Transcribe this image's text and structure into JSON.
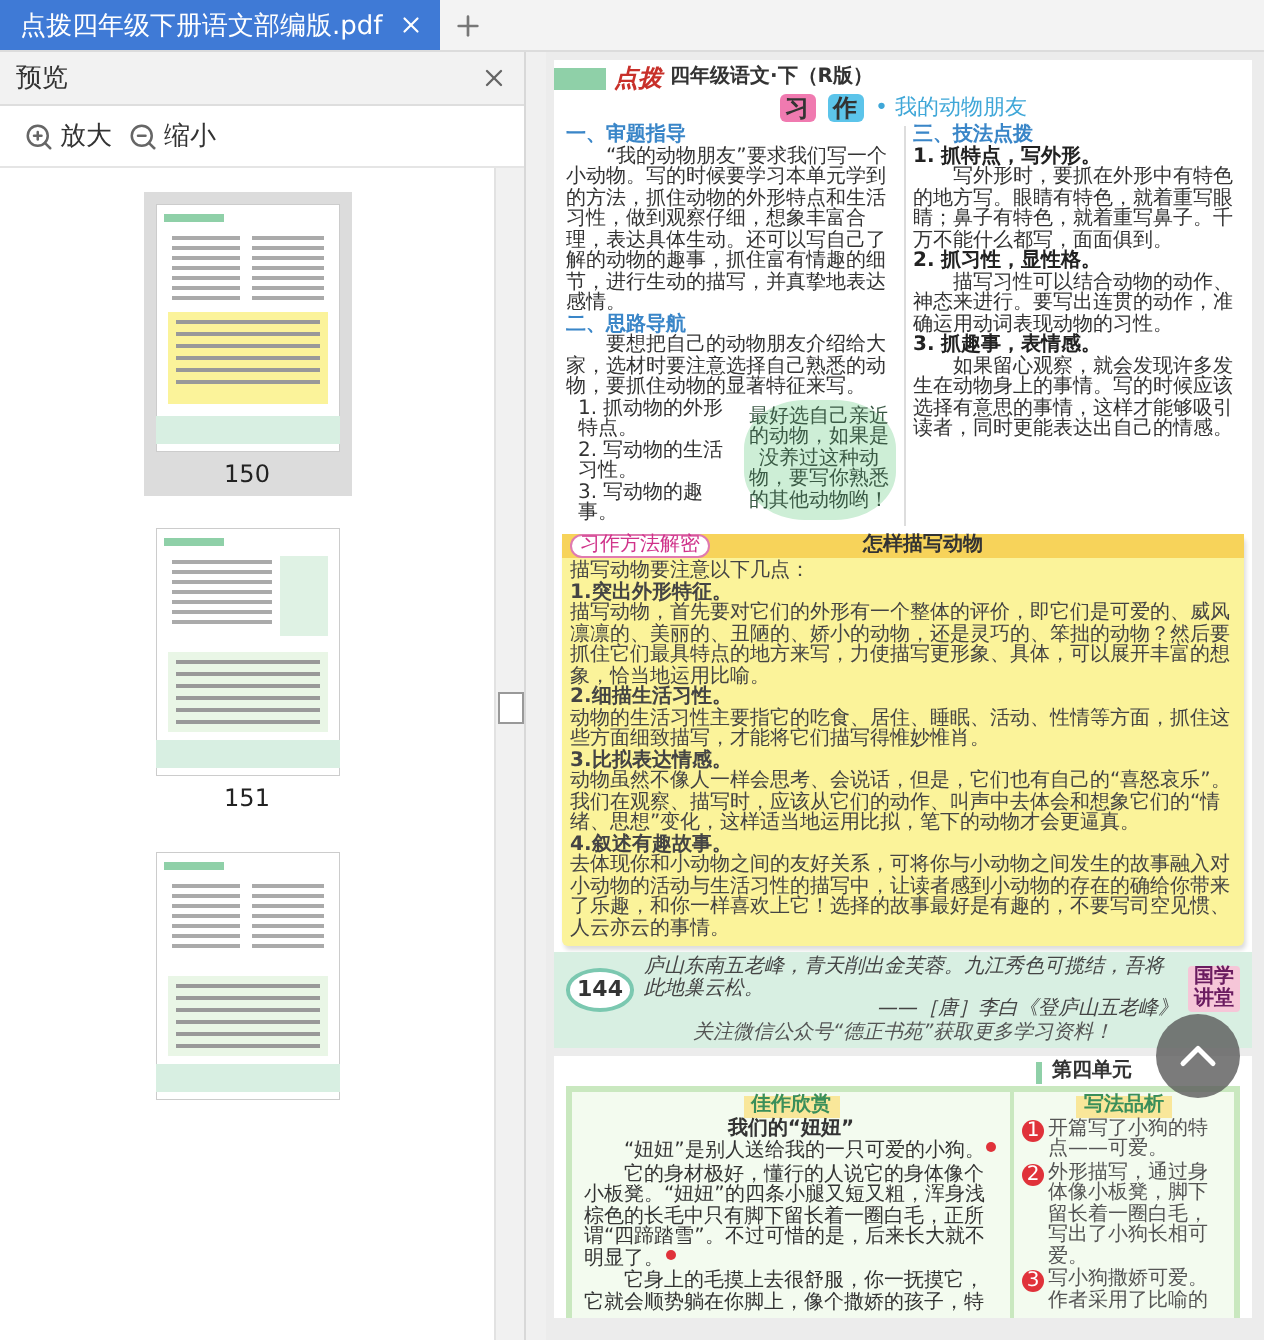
{
  "tab": {
    "title": "点拨四年级下册语文部编版.pdf",
    "selected": true
  },
  "sidebar": {
    "title": "预览",
    "zoom_in": "放大",
    "zoom_out": "缩小",
    "thumbnails": [
      {
        "label": "150",
        "selected": true
      },
      {
        "label": "151",
        "selected": false
      },
      {
        "selected": false
      }
    ]
  },
  "page_1": {
    "brand": "点拨",
    "header": "四年级语文·下（R版）",
    "section_badge": [
      "习",
      "作"
    ],
    "section_title": "• 我的动物朋友",
    "columns": [
      [
        {
          "kind": "heading",
          "text": "一、审题指导"
        },
        {
          "kind": "para",
          "text": "“我的动物朋友”要求我们写一个小动物。写的时候要学习本单元学到的方法，抓住动物的外形特点和生活习性，做到观察仔细，想象丰富合理，表达具体生动。还可以写自己了解的动物的趣事，抓住富有情趣的细节，进行生动的描写，并真挚地表达感情。"
        },
        {
          "kind": "heading",
          "text": "二、思路导航"
        },
        {
          "kind": "para",
          "text": "要想把自己的动物朋友介绍给大家，选材时要注意选择自己熟悉的动物，要抓住动物的显著特征来写。"
        },
        {
          "kind": "item",
          "text": "1. 抓动物的外形特点。"
        },
        {
          "kind": "item",
          "text": "2. 写动物的生活习性。"
        },
        {
          "kind": "item",
          "text": "3. 写动物的趣事。"
        }
      ],
      [
        {
          "kind": "heading",
          "text": "三、技法点拨"
        },
        {
          "kind": "subhead",
          "text": "1. 抓特点，写外形。"
        },
        {
          "kind": "para",
          "text": "写外形时，要抓在外形中有特色的地方写。眼睛有特色，就着重写眼睛；鼻子有特色，就着重写鼻子。千万不能什么都写，面面俱到。"
        },
        {
          "kind": "subhead",
          "text": "2. 抓习性，显性格。"
        },
        {
          "kind": "para",
          "text": "描写习性可以结合动物的动作、神态来进行。要写出连贯的动作，准确运用动词表现动物的习性。"
        },
        {
          "kind": "subhead",
          "text": "3. 抓趣事，表情感。"
        },
        {
          "kind": "para",
          "text": "如果留心观察，就会发现许多发生在动物身上的事情。写的时候应该选择有意思的事情，这样才能够吸引读者，同时更能表达出自己的情感。"
        }
      ]
    ],
    "bubble": "最好选自己亲近的动物，如果是没养过这种动物，要写你熟悉的其他动物哟！",
    "tip_box": {
      "tag": "习作方法解密",
      "title": "怎样描写动物",
      "lines": [
        {
          "kind": "para",
          "text": "描写动物要注意以下几点："
        },
        {
          "kind": "item",
          "text": "1.突出外形特征。"
        },
        {
          "kind": "para",
          "text": "描写动物，首先要对它们的外形有一个整体的评价，即它们是可爱的、威风凛凛的、美丽的、丑陋的、娇小的动物，还是灵巧的、笨拙的动物？然后要抓住它们最具特点的地方来写，力使描写更形象、具体，可以展开丰富的想象，恰当地运用比喻。"
        },
        {
          "kind": "item",
          "text": "2.细描生活习性。"
        },
        {
          "kind": "para",
          "text": "动物的生活习性主要指它的吃食、居住、睡眠、活动、性情等方面，抓住这些方面细致描写，才能将它们描写得惟妙惟肖。"
        },
        {
          "kind": "item",
          "text": "3.比拟表达情感。"
        },
        {
          "kind": "para",
          "text": "动物虽然不像人一样会思考、会说话，但是，它们也有自己的“喜怒哀乐”。我们在观察、描写时，应该从它们的动作、叫声中去体会和想象它们的“情绪、思想”变化，这样适当地运用比拟，笔下的动物才会更逼真。"
        },
        {
          "kind": "item",
          "text": "4.叙述有趣故事。"
        },
        {
          "kind": "para",
          "text": "去体现你和小动物之间的友好关系，可将你与小动物之间发生的故事融入对小动物的活动与生活习性的描写中，让读者感到小动物的存在的确给你带来了乐趣，和你一样喜欢上它！选择的故事最好是有趣的，不要写司空见惯、人云亦云的事情。"
        }
      ]
    },
    "footer": {
      "page_number": "144",
      "quote": "庐山东南五老峰，青天削出金芙蓉。九江秀色可揽结，吾将此地巢云松。",
      "source": "——［唐］李白《登庐山五老峰》",
      "badge": "国学讲堂",
      "note": "关注微信公众号“德正书苑”获取更多学习资料！"
    }
  },
  "page_2": {
    "unit": "第四单元",
    "left_tag": "佳作欣赏",
    "right_tag": "写法品析",
    "essay_title": "我们的“妞妞”",
    "paragraphs": [
      {
        "text": "“妞妞”是别人送给我的一只可爱的小狗。",
        "marked": true
      },
      {
        "text": "它的身材极好，懂行的人说它的身体像个小板凳。“妞妞”的四条小腿又短又粗，浑身浅棕色的长毛中只有脚下留长着一圈白毛，正所谓“四蹄踏雪”。不过可惜的是，后来长大就不明显了。",
        "marked": true
      },
      {
        "text": "它身上的毛摸上去很舒服，你一抚摸它，它就会顺势躺在你脚上，像个撒娇的孩子，特",
        "marked": false
      }
    ],
    "notes": [
      {
        "number": "1",
        "text": "开篇写了小狗的特点——可爱。"
      },
      {
        "number": "2",
        "text": "外形描写，通过身体像小板凳，脚下留长着一圈白毛，写出了小狗长相可爱。"
      },
      {
        "number": "3",
        "text": "写小狗撒娇可爱。作者采用了比喻的"
      }
    ]
  }
}
